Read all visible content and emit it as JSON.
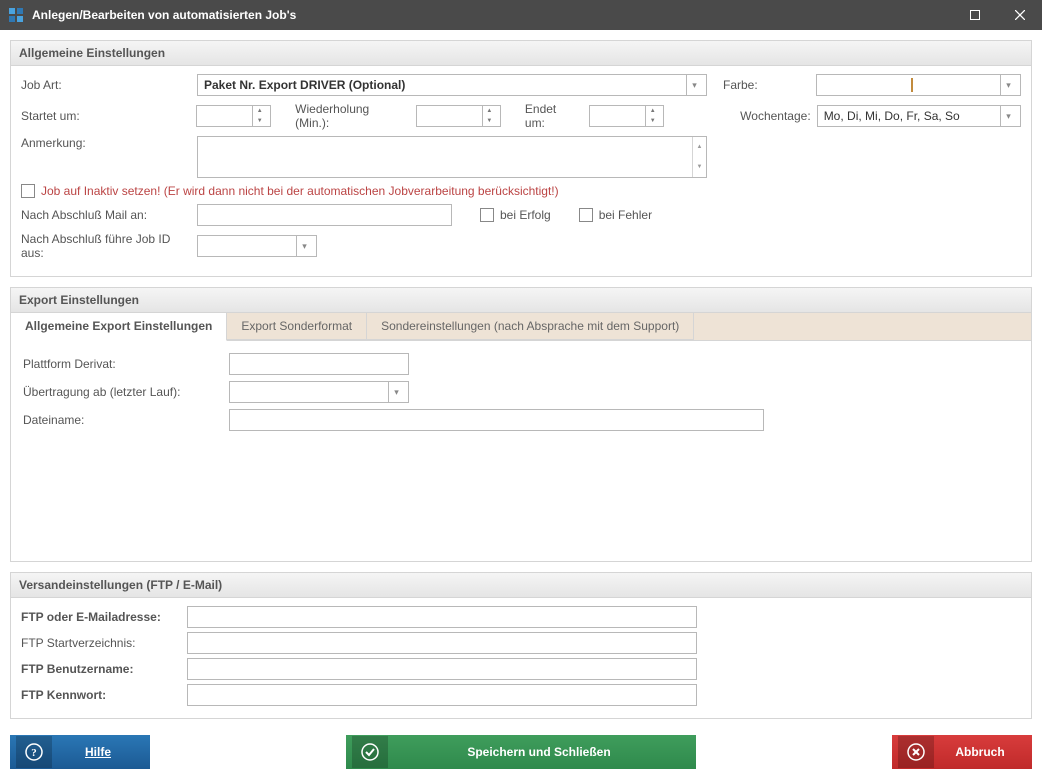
{
  "window": {
    "title": "Anlegen/Bearbeiten von automatisierten Job's"
  },
  "panels": {
    "general": "Allgemeine Einstellungen",
    "export": "Export Einstellungen",
    "shipping": "Versandeinstellungen (FTP / E-Mail)"
  },
  "labels": {
    "job_art": "Job Art:",
    "farbe": "Farbe:",
    "startet_um": "Startet um:",
    "wiederholung": "Wiederholung (Min.):",
    "endet_um": "Endet um:",
    "wochentage": "Wochentage:",
    "anmerkung": "Anmerkung:",
    "inactive_lead": "Job auf Inaktiv setzen! ",
    "inactive_note": "(Er wird dann nicht bei der automatischen Jobverarbeitung berücksichtigt!)",
    "nach_mail": "Nach Abschluß Mail an:",
    "bei_erfolg": "bei Erfolg",
    "bei_fehler": "bei Fehler",
    "nach_jobid": "Nach Abschluß führe Job ID aus:",
    "plattform_derivat": "Plattform Derivat:",
    "uebertragung_ab": "Übertragung ab (letzter Lauf):",
    "dateiname": "Dateiname:",
    "ftp_email": "FTP oder E-Mailadresse:",
    "ftp_start": "FTP Startverzeichnis:",
    "ftp_user": "FTP Benutzername:",
    "ftp_pass": "FTP Kennwort:"
  },
  "tabs": {
    "t1": "Allgemeine Export Einstellungen",
    "t2": "Export Sonderformat",
    "t3": "Sondereinstellungen (nach Absprache mit dem Support)"
  },
  "values": {
    "job_art": "Paket Nr. Export DRIVER (Optional)",
    "farbe": "",
    "startet_um": "",
    "wiederholung": "",
    "endet_um": "",
    "wochentage": "Mo, Di, Mi, Do, Fr, Sa, So",
    "anmerkung": "",
    "mail_to": "",
    "job_id_after": "",
    "plattform_derivat": "",
    "uebertragung_ab": "",
    "dateiname": "",
    "ftp_email": "",
    "ftp_start": "",
    "ftp_user": "",
    "ftp_pass": ""
  },
  "buttons": {
    "help": "Hilfe",
    "save": "Speichern und Schließen",
    "cancel": "Abbruch"
  }
}
